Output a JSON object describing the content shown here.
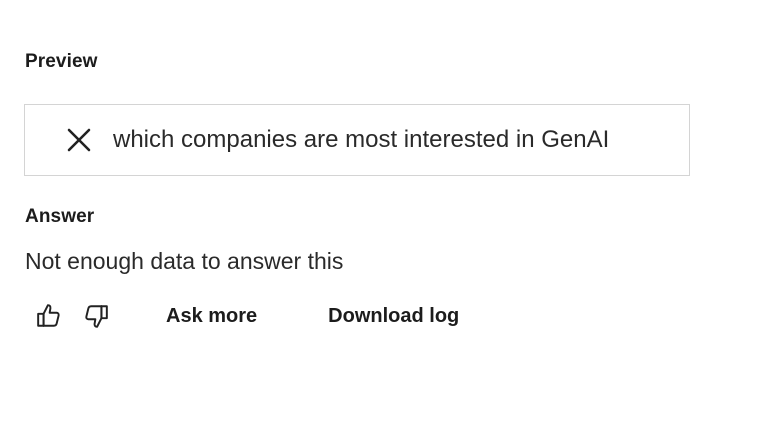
{
  "preview": {
    "title": "Preview",
    "query": "which companies are most interested in GenAI",
    "clear_icon": "close-icon"
  },
  "answer": {
    "title": "Answer",
    "text": "Not enough data to answer this"
  },
  "actions": {
    "thumbs_up_icon": "thumbs-up-icon",
    "thumbs_down_icon": "thumbs-down-icon",
    "ask_more_label": "Ask more",
    "download_log_label": "Download log"
  }
}
